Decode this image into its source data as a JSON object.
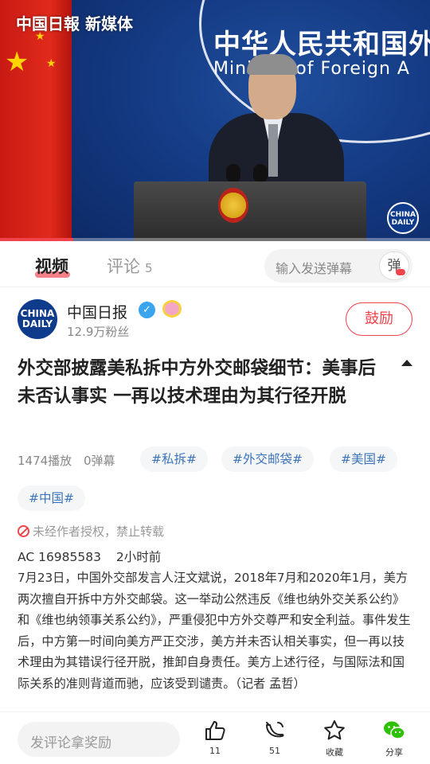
{
  "video": {
    "watermark": "中国日報 新媒体",
    "ministry_cn": "中华人民共和国外",
    "ministry_en": "Ministry of Foreign A",
    "corner_logo": "CHINA DAILY",
    "progress_fraction": 0.17
  },
  "tabs": {
    "video_label": "视频",
    "comment_label": "评论",
    "comment_count": "5",
    "danmu_placeholder": "输入发送弹幕",
    "danmu_toggle_label": "弹"
  },
  "author": {
    "avatar_text": "CHINA DAILY",
    "name": "中国日报",
    "fans": "12.9万粉丝",
    "follow_label": "鼓励",
    "verified_icon": "check-badge-icon",
    "medal_icon": "medal-icon"
  },
  "article": {
    "title": "外交部披露美私拆中方外交邮袋细节：美事后未否认事实 一再以技术理由为其行径开脱",
    "plays": "1474播放",
    "danmu": "0弹幕",
    "tags": [
      "#私拆#",
      "#外交邮袋#",
      "#美国#",
      "#中国#"
    ],
    "warning": "未经作者授权，禁止转载",
    "ac_id": "AC 16985583",
    "time": "2小时前",
    "description": "7月23日，中国外交部发言人汪文斌说，2018年7月和2020年1月，美方两次擅自开拆中方外交邮袋。这一举动公然违反《维也纳外交关系公约》和《维也纳领事关系公约》，严重侵犯中方外交尊严和安全利益。事件发生后，中方第一时间向美方严正交涉，美方并未否认相关事实，但一再以技术理由为其错误行径开脱，推卸自身责任。美方上述行径，与国际法和国际关系的准则背道而驰，应该受到谴责。（记者 孟哲）"
  },
  "bottom": {
    "comment_placeholder": "发评论拿奖励",
    "like_count": "11",
    "banana_count": "51",
    "collect_label": "收藏",
    "share_label": "分享"
  },
  "colors": {
    "accent": "#f0434b",
    "tag_text": "#3e74b9",
    "tag_bg": "#f4f6f8",
    "share_green": "#2dc100"
  }
}
